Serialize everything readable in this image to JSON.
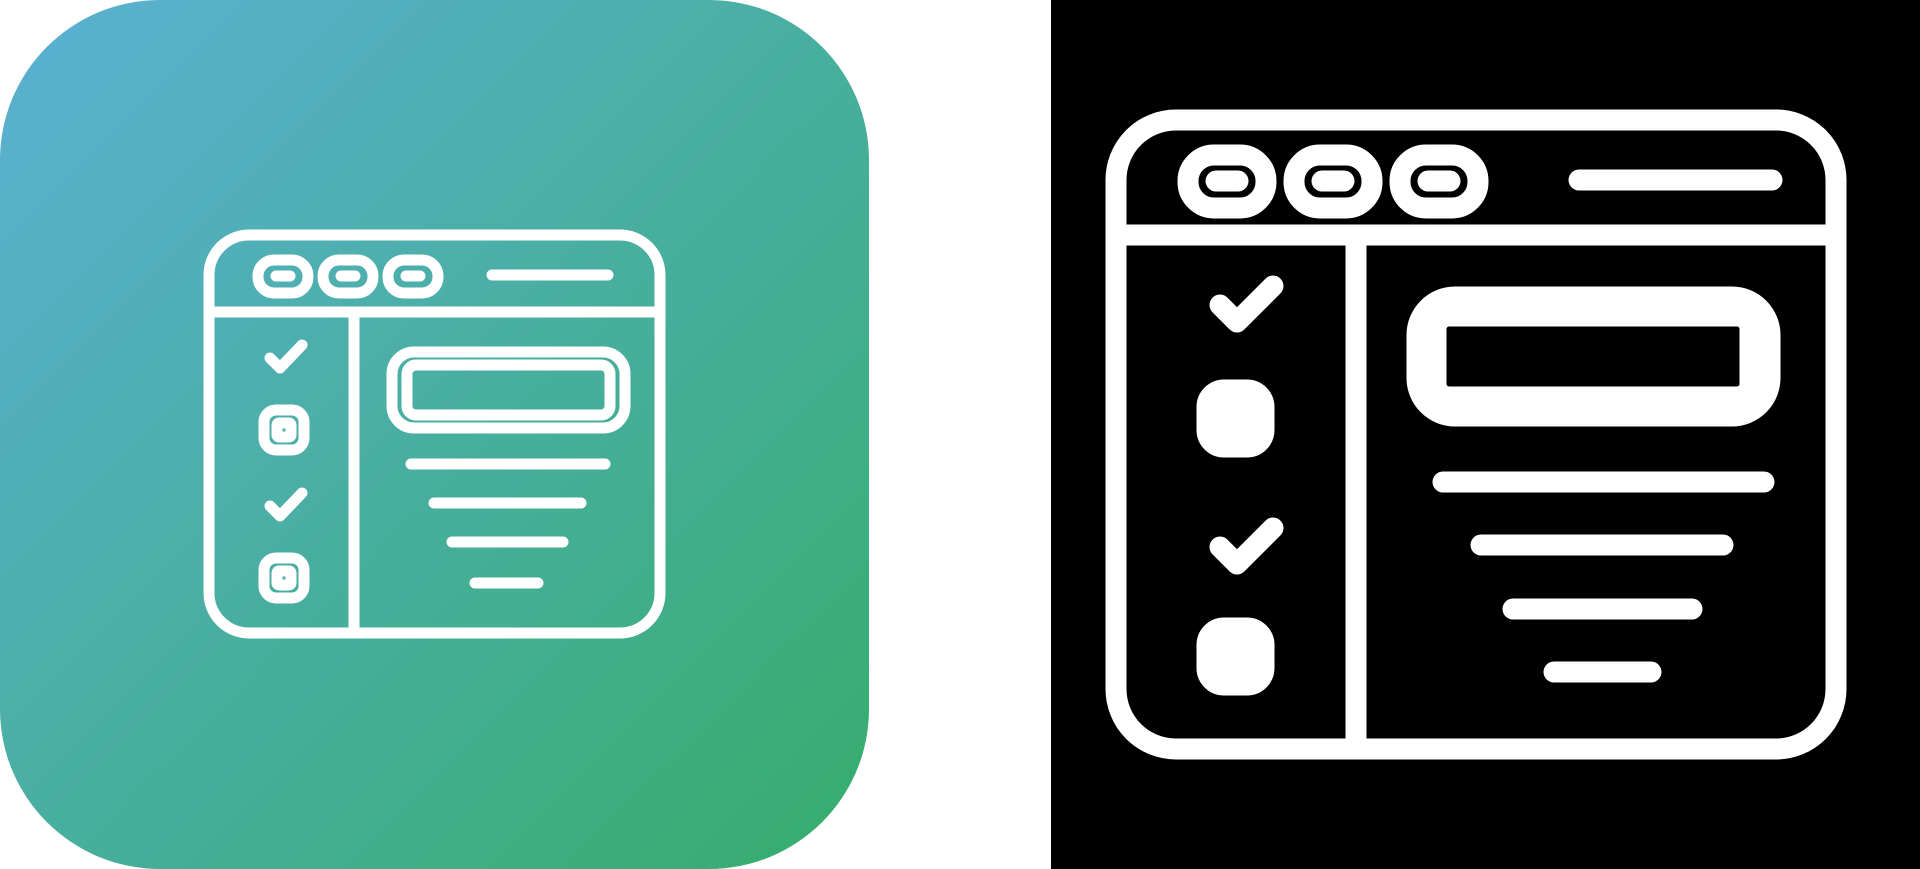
{
  "icon": "browser-checklist-icon",
  "variants": [
    {
      "name": "gradient-variant",
      "background": {
        "gradient_start": "#5bb0d4",
        "gradient_end": "#36ad6c"
      },
      "stroke_color": "#ffffff"
    },
    {
      "name": "dark-variant",
      "background": {
        "color": "#000000"
      },
      "stroke_color": "#ffffff"
    }
  ],
  "checklist": [
    "checked",
    "unchecked",
    "checked",
    "unchecked"
  ]
}
